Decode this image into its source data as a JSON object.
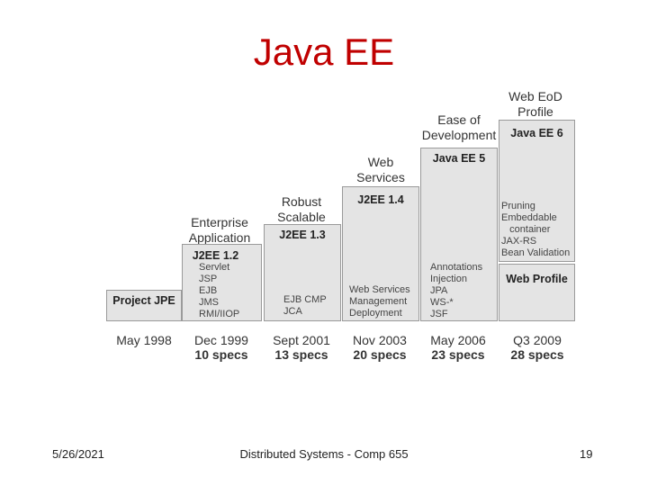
{
  "title": "Java EE",
  "columns": [
    {
      "caption": [
        "",
        ""
      ],
      "version": "Project JPE",
      "features": [],
      "date": "May 1998",
      "specs": ""
    },
    {
      "caption": [
        "Enterprise",
        "Application"
      ],
      "version": "J2EE 1.2",
      "features": [
        "Servlet",
        "JSP",
        "EJB",
        "JMS",
        "RMI/IIOP"
      ],
      "date": "Dec 1999",
      "specs": "10 specs"
    },
    {
      "caption": [
        "Robust",
        "Scalable"
      ],
      "version": "J2EE 1.3",
      "features": [
        "EJB CMP",
        "JCA"
      ],
      "date": "Sept 2001",
      "specs": "13 specs"
    },
    {
      "caption": [
        "Web",
        "Services"
      ],
      "version": "J2EE 1.4",
      "features": [
        "Web Services",
        "Management",
        "Deployment"
      ],
      "date": "Nov 2003",
      "specs": "20 specs"
    },
    {
      "caption": [
        "Ease of",
        "Development"
      ],
      "version": "Java EE 5",
      "features": [
        "Annotations",
        "Injection",
        "JPA",
        "WS-*",
        "JSF"
      ],
      "date": "May 2006",
      "specs": "23 specs"
    },
    {
      "caption": [
        "Web EoD",
        "Profile"
      ],
      "version": "Java EE 6",
      "features": [
        "Pruning",
        "Embeddable",
        "   container",
        "JAX-RS",
        "Bean Validation"
      ],
      "profile": "Web Profile",
      "date": "Q3 2009",
      "specs": "28 specs"
    }
  ],
  "footer": {
    "date": "5/26/2021",
    "course": "Distributed Systems - Comp 655",
    "page": "19"
  }
}
